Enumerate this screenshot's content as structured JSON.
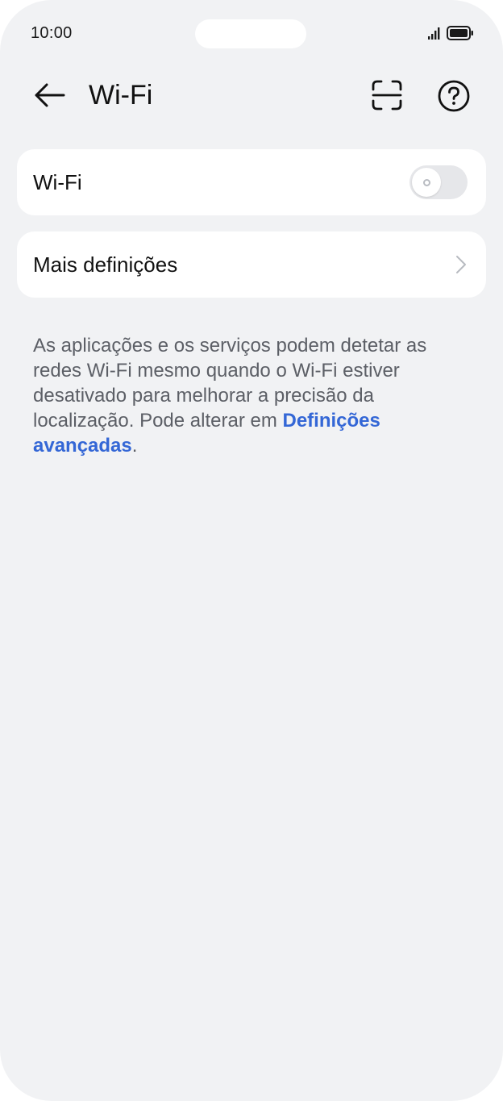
{
  "status_bar": {
    "time": "10:00",
    "signal_icon": "signal-bars-icon",
    "battery_icon": "battery-icon"
  },
  "header": {
    "title": "Wi-Fi",
    "back_icon": "arrow-left-icon",
    "scan_icon": "scan-frame-icon",
    "help_icon": "help-circle-icon"
  },
  "wifi_toggle": {
    "label": "Wi-Fi",
    "enabled": false
  },
  "more_settings": {
    "label": "Mais definições",
    "chevron_icon": "chevron-right-icon"
  },
  "info": {
    "text": "As aplicações e os serviços podem detetar as redes Wi-Fi mesmo quando o Wi-Fi estiver desativado para melhorar a precisão da localização. Pode alterar em ",
    "link_text": "Definições avançadas",
    "trailing": "."
  },
  "colors": {
    "background": "#f1f2f4",
    "card": "#ffffff",
    "link": "#3467d6",
    "toggle_off": "#e6e7ea"
  }
}
